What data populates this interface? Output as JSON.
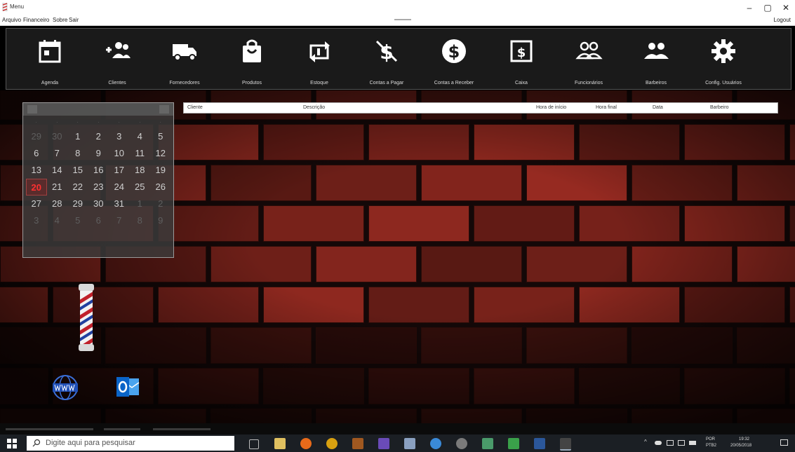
{
  "window": {
    "title": "Menu",
    "controls": [
      "–",
      "▢",
      "✕"
    ]
  },
  "menubar": {
    "items": [
      "Arquivo",
      "Financeiro",
      "Sobre",
      "Sair"
    ],
    "logout": "Logout"
  },
  "toolbar": {
    "items": [
      {
        "label": "Agenda",
        "icon": "calendar-icon"
      },
      {
        "label": "Clientes",
        "icon": "add-users-icon"
      },
      {
        "label": "Fornecedores",
        "icon": "truck-icon"
      },
      {
        "label": "Produtos",
        "icon": "shopping-bag-icon"
      },
      {
        "label": "Estoque",
        "icon": "stock-arrows-icon"
      },
      {
        "label": "Contas a Pagar",
        "icon": "money-off-icon"
      },
      {
        "label": "Contas a Receber",
        "icon": "dollar-circle-icon"
      },
      {
        "label": "Caixa",
        "icon": "cash-register-icon"
      },
      {
        "label": "Funcionários",
        "icon": "employees-icon"
      },
      {
        "label": "Barbeiros",
        "icon": "barbers-icon"
      },
      {
        "label": "Config. Usuários",
        "icon": "gear-icon"
      }
    ]
  },
  "calendar": {
    "rows": [
      [
        {
          "d": "29",
          "m": true
        },
        {
          "d": "30",
          "m": true
        },
        {
          "d": "1"
        },
        {
          "d": "2"
        },
        {
          "d": "3"
        },
        {
          "d": "4"
        },
        {
          "d": "5"
        }
      ],
      [
        {
          "d": "6"
        },
        {
          "d": "7"
        },
        {
          "d": "8"
        },
        {
          "d": "9"
        },
        {
          "d": "10"
        },
        {
          "d": "11"
        },
        {
          "d": "12"
        }
      ],
      [
        {
          "d": "13"
        },
        {
          "d": "14"
        },
        {
          "d": "15"
        },
        {
          "d": "16"
        },
        {
          "d": "17"
        },
        {
          "d": "18"
        },
        {
          "d": "19"
        }
      ],
      [
        {
          "d": "20",
          "today": true
        },
        {
          "d": "21"
        },
        {
          "d": "22"
        },
        {
          "d": "23"
        },
        {
          "d": "24"
        },
        {
          "d": "25"
        },
        {
          "d": "26"
        }
      ],
      [
        {
          "d": "27"
        },
        {
          "d": "28"
        },
        {
          "d": "29"
        },
        {
          "d": "30"
        },
        {
          "d": "31"
        },
        {
          "d": "1",
          "m": true
        },
        {
          "d": "2",
          "m": true
        }
      ],
      [
        {
          "d": "3",
          "m": true
        },
        {
          "d": "4",
          "m": true
        },
        {
          "d": "5",
          "m": true
        },
        {
          "d": "6",
          "m": true
        },
        {
          "d": "7",
          "m": true
        },
        {
          "d": "8",
          "m": true
        },
        {
          "d": "9",
          "m": true
        }
      ]
    ]
  },
  "appointments_table": {
    "columns": [
      "Cliente",
      "Descrição",
      "Hora de início",
      "Hora final",
      "Data",
      "Barbeiro"
    ]
  },
  "taskbar": {
    "search_placeholder": "Digite aqui para pesquisar",
    "language": "POR",
    "layout": "PTB2",
    "time": "19:32",
    "date": "20/05/2018"
  },
  "colors": {
    "toolbar_bg": "#1a1a1a",
    "today_highlight": "#ff3030",
    "taskbar_bg": "#1b1f24"
  }
}
